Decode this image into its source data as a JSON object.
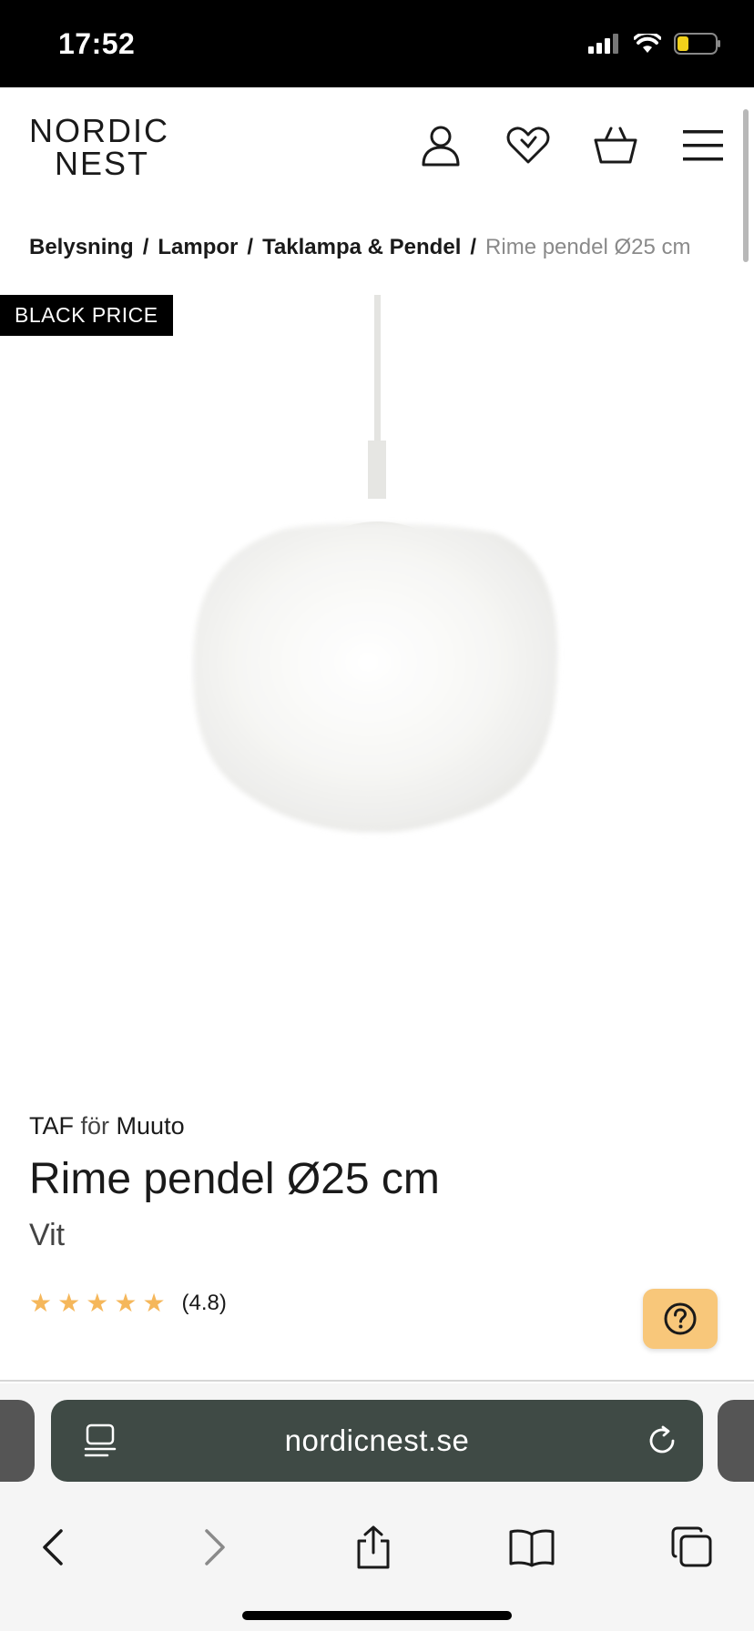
{
  "status_bar": {
    "time": "17:52"
  },
  "header": {
    "logo_line1": "NORDIC",
    "logo_line2": "NEST",
    "icons": [
      "user-icon",
      "heart-icon",
      "basket-icon",
      "menu-icon"
    ]
  },
  "breadcrumb": {
    "items": [
      "Belysning",
      "Lampor",
      "Taklampa & Pendel"
    ],
    "separator": "/",
    "current": "Rime pendel Ø25 cm"
  },
  "product": {
    "badge": "BLACK PRICE",
    "designer": "TAF",
    "for_word": "för",
    "brand": "Muuto",
    "title": "Rime pendel Ø25 cm",
    "variant": "Vit",
    "rating": 4.8,
    "rating_text": "(4.8)",
    "star_color": "#f5b75b"
  },
  "help_button": {
    "icon": "question-icon",
    "color": "#f8c77a"
  },
  "browser": {
    "url": "nordicnest.se",
    "toolbar_icons": [
      "back-icon",
      "forward-icon",
      "share-icon",
      "bookmarks-icon",
      "tabs-icon"
    ]
  }
}
